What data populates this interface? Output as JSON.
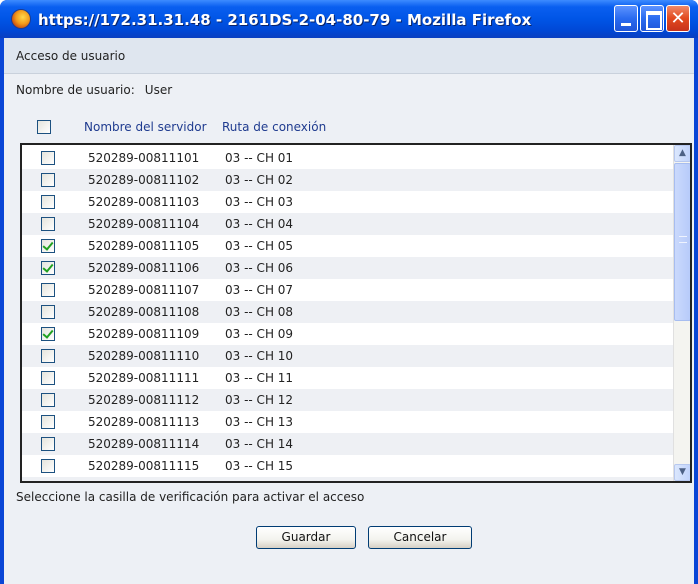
{
  "window": {
    "title": "https://172.31.31.48 - 2161DS-2-04-80-79 - Mozilla Firefox",
    "icon": "firefox-icon",
    "controls": {
      "close_glyph": "✕"
    }
  },
  "header": {
    "label": "Acceso de usuario"
  },
  "user": {
    "label": "Nombre de usuario:",
    "value": "User"
  },
  "table": {
    "select_all_checked": false,
    "columns": [
      "Nombre del servidor",
      "Ruta de conexión"
    ],
    "rows": [
      {
        "checked": false,
        "server": "520289-00811101",
        "path": "03 -- CH 01"
      },
      {
        "checked": false,
        "server": "520289-00811102",
        "path": "03 -- CH 02"
      },
      {
        "checked": false,
        "server": "520289-00811103",
        "path": "03 -- CH 03"
      },
      {
        "checked": false,
        "server": "520289-00811104",
        "path": "03 -- CH 04"
      },
      {
        "checked": true,
        "server": "520289-00811105",
        "path": "03 -- CH 05"
      },
      {
        "checked": true,
        "server": "520289-00811106",
        "path": "03 -- CH 06"
      },
      {
        "checked": false,
        "server": "520289-00811107",
        "path": "03 -- CH 07"
      },
      {
        "checked": false,
        "server": "520289-00811108",
        "path": "03 -- CH 08"
      },
      {
        "checked": true,
        "server": "520289-00811109",
        "path": "03 -- CH 09"
      },
      {
        "checked": false,
        "server": "520289-00811110",
        "path": "03 -- CH 10"
      },
      {
        "checked": false,
        "server": "520289-00811111",
        "path": "03 -- CH 11"
      },
      {
        "checked": false,
        "server": "520289-00811112",
        "path": "03 -- CH 12"
      },
      {
        "checked": false,
        "server": "520289-00811113",
        "path": "03 -- CH 13"
      },
      {
        "checked": false,
        "server": "520289-00811114",
        "path": "03 -- CH 14"
      },
      {
        "checked": false,
        "server": "520289-00811115",
        "path": "03 -- CH 15"
      }
    ]
  },
  "hint": "Seleccione la casilla de verificación para activar el acceso",
  "buttons": {
    "save": "Guardar",
    "cancel": "Cancelar"
  },
  "colors": {
    "titlebar": "#0055e6",
    "header_link": "#1f3b8f",
    "check": "#21a121"
  }
}
